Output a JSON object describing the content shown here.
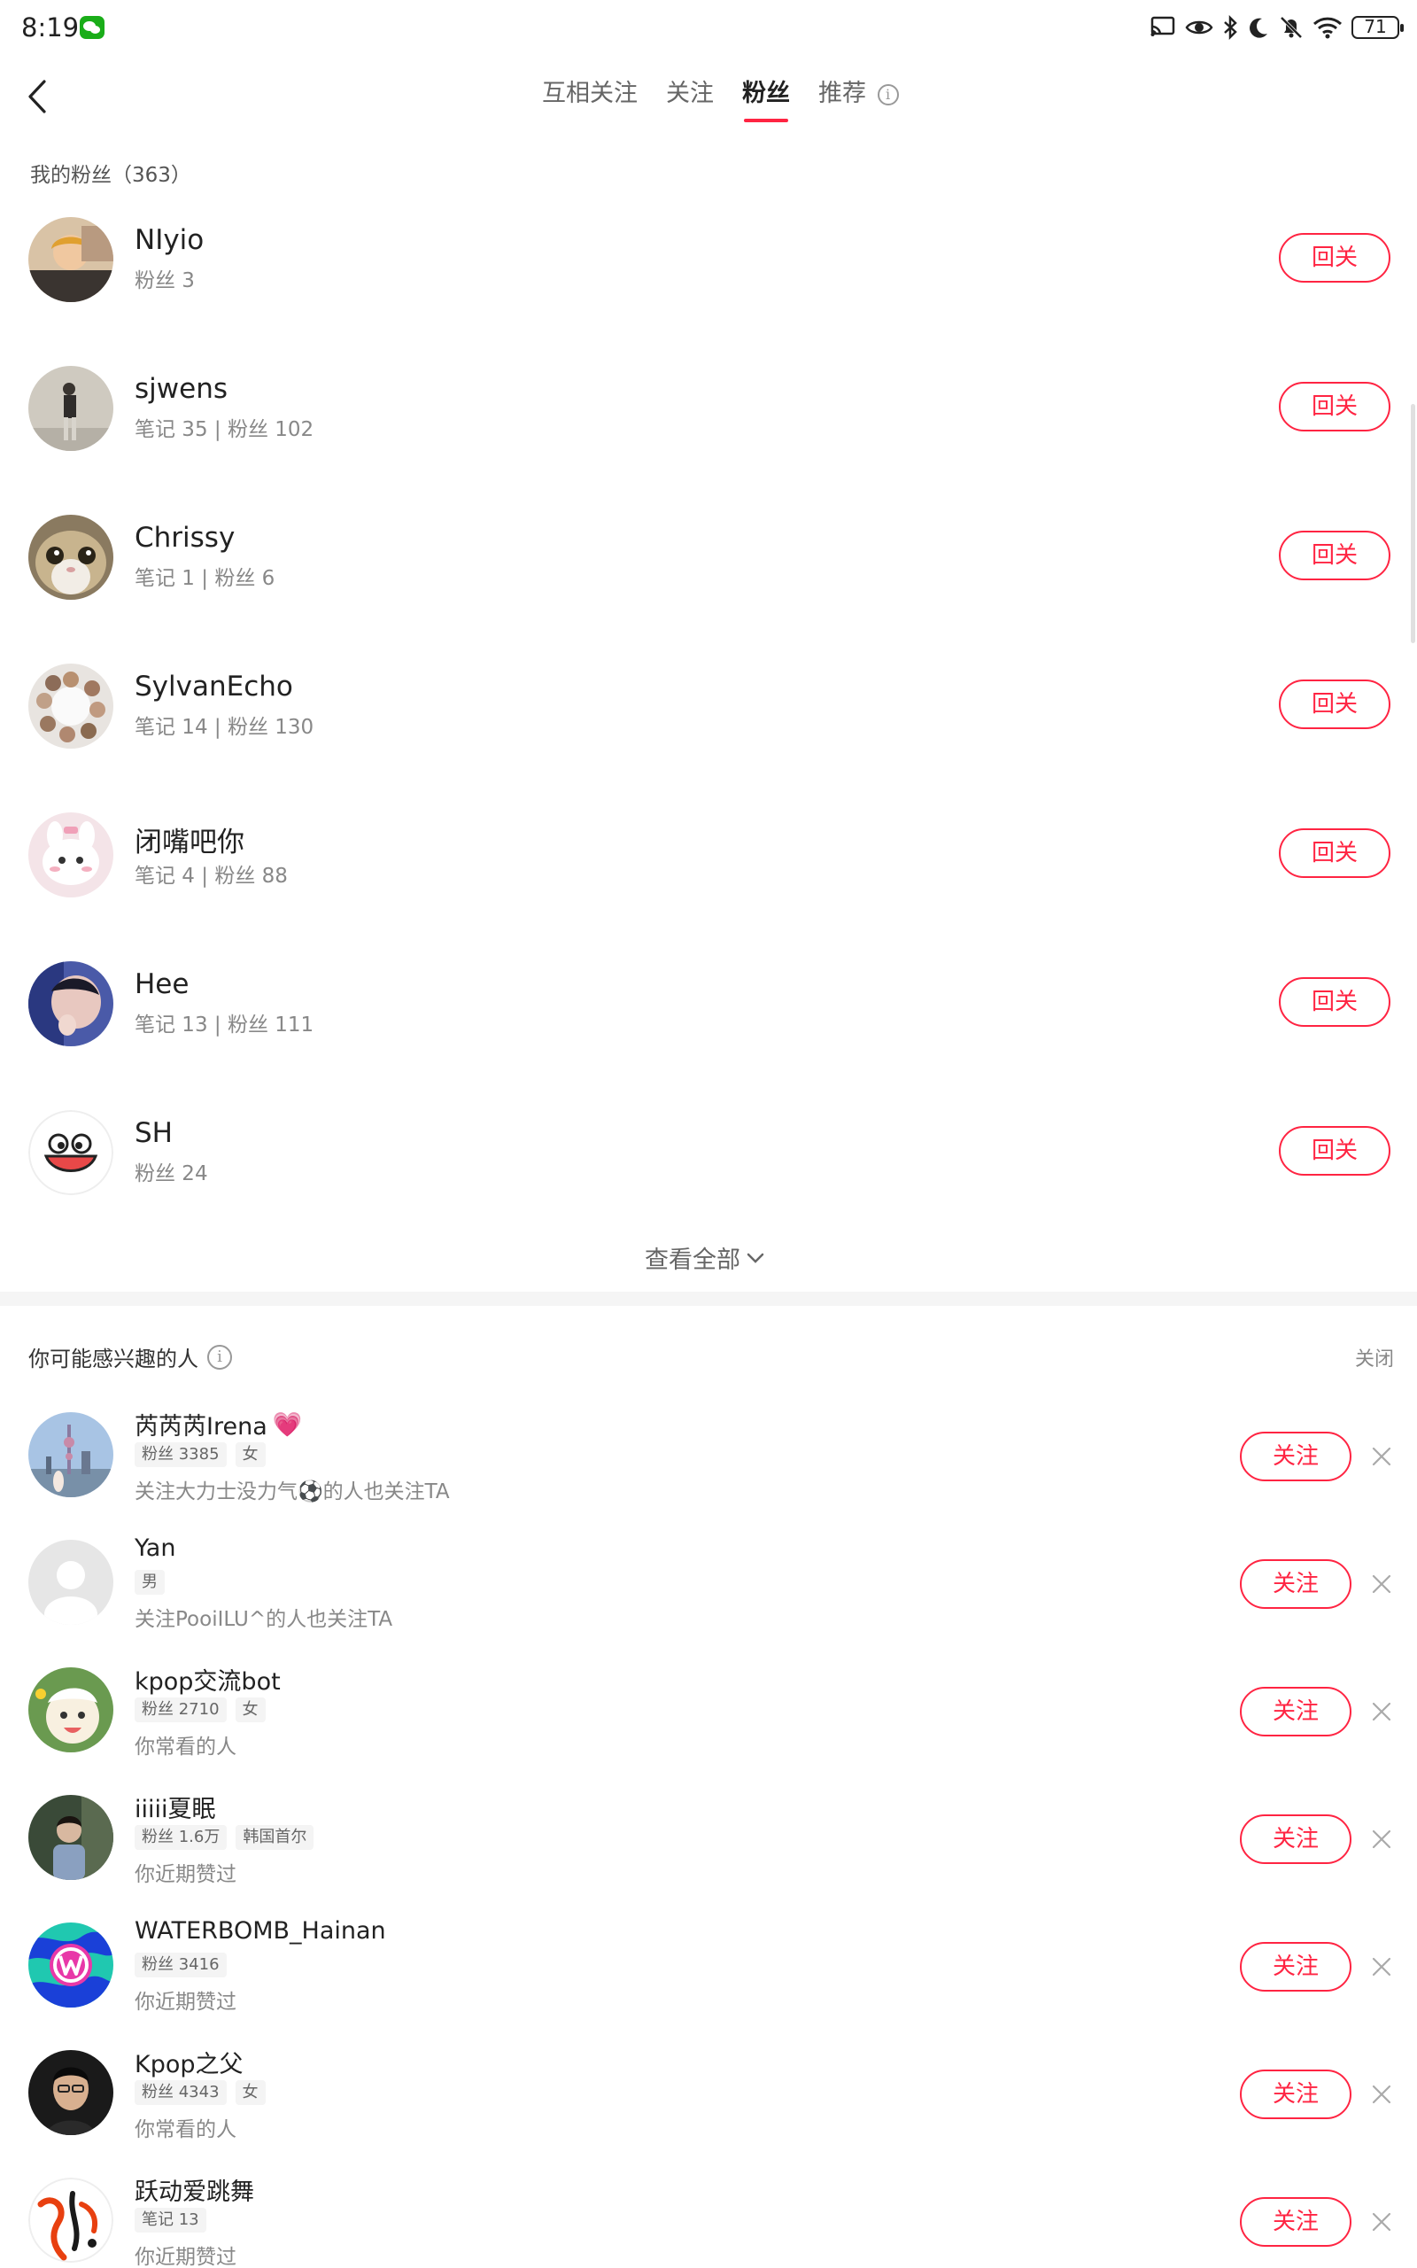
{
  "status_bar": {
    "time": "8:19",
    "battery": "71"
  },
  "header": {
    "tabs": [
      {
        "label": "互相关注",
        "active": false
      },
      {
        "label": "关注",
        "active": false
      },
      {
        "label": "粉丝",
        "active": true
      },
      {
        "label": "推荐",
        "active": false
      }
    ],
    "info_glyph": "i"
  },
  "fans": {
    "title": "我的粉丝（363）",
    "items": [
      {
        "name": "NIyio",
        "meta": "粉丝 3",
        "button": "回关"
      },
      {
        "name": "sjwens",
        "meta": "笔记 35 | 粉丝 102",
        "button": "回关"
      },
      {
        "name": "Chrissy",
        "meta": "笔记 1 | 粉丝 6",
        "button": "回关"
      },
      {
        "name": "SylvanEcho",
        "meta": "笔记 14 | 粉丝 130",
        "button": "回关"
      },
      {
        "name": "闭嘴吧你",
        "meta": "笔记 4 | 粉丝 88",
        "button": "回关"
      },
      {
        "name": "Hee",
        "meta": "笔记 13 | 粉丝 111",
        "button": "回关"
      },
      {
        "name": "SH",
        "meta": "粉丝 24",
        "button": "回关"
      }
    ],
    "view_all": "查看全部"
  },
  "suggestions": {
    "title": "你可能感兴趣的人",
    "close_label": "关闭",
    "items": [
      {
        "name": "芮芮芮Irena",
        "emoji": "💗",
        "tags": [
          "粉丝 3385",
          "女"
        ],
        "reason": "关注大力士没力气⚽的人也关注TA",
        "button": "关注"
      },
      {
        "name": "Yan",
        "emoji": "",
        "tags": [
          "男"
        ],
        "reason": "关注PooiILU^的人也关注TA",
        "button": "关注"
      },
      {
        "name": "kpop交流bot",
        "emoji": "",
        "tags": [
          "粉丝 2710",
          "女"
        ],
        "reason": "你常看的人",
        "button": "关注"
      },
      {
        "name": "iiiii夏眠",
        "emoji": "",
        "tags": [
          "粉丝 1.6万",
          "韩国首尔"
        ],
        "reason": "你近期赞过",
        "button": "关注"
      },
      {
        "name": "WATERBOMB_Hainan",
        "emoji": "",
        "tags": [
          "粉丝 3416"
        ],
        "reason": "你近期赞过",
        "button": "关注"
      },
      {
        "name": "Kpop之父",
        "emoji": "",
        "tags": [
          "粉丝 4343",
          "女"
        ],
        "reason": "你常看的人",
        "button": "关注"
      },
      {
        "name": "跃动爱跳舞",
        "emoji": "",
        "tags": [
          "笔记 13"
        ],
        "reason": "你近期赞过",
        "button": "关注"
      }
    ]
  },
  "colors": {
    "accent": "#ff2442",
    "text": "#222222",
    "muted": "#888888",
    "tag_bg": "#f4f4f4"
  }
}
